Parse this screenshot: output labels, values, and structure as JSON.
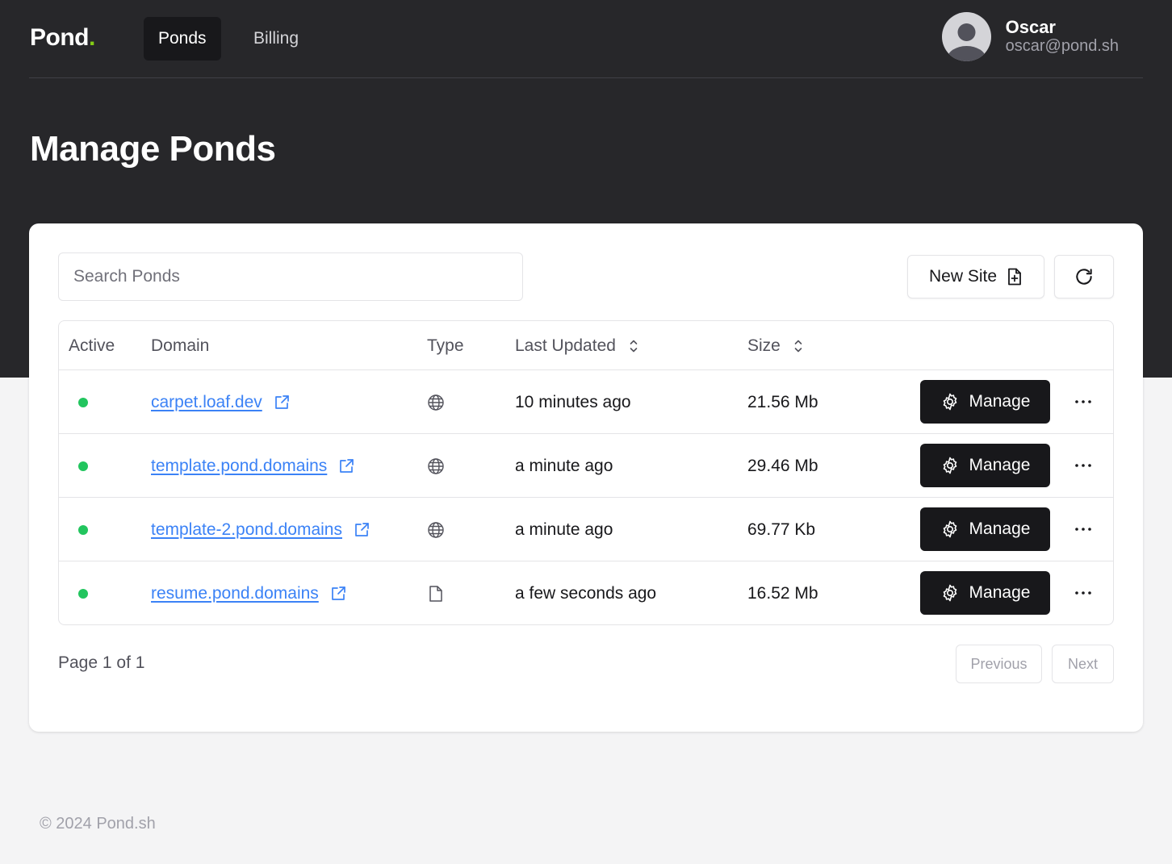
{
  "brand": {
    "name": "Pond",
    "dot": ".",
    "dot_color": "#84cc16"
  },
  "nav": {
    "tabs": [
      {
        "label": "Ponds",
        "active": true
      },
      {
        "label": "Billing",
        "active": false
      }
    ]
  },
  "user": {
    "name": "Oscar",
    "email": "oscar@pond.sh"
  },
  "page": {
    "title": "Manage Ponds"
  },
  "toolbar": {
    "search_placeholder": "Search Ponds",
    "search_value": "",
    "new_site_label": "New Site"
  },
  "table": {
    "headers": {
      "active": "Active",
      "domain": "Domain",
      "type": "Type",
      "last_updated": "Last Updated",
      "size": "Size"
    },
    "rows": [
      {
        "active": true,
        "domain": "carpet.loaf.dev",
        "type_icon": "globe-icon",
        "last_updated": "10 minutes ago",
        "size": "21.56 Mb",
        "action": "Manage"
      },
      {
        "active": true,
        "domain": "template.pond.domains",
        "type_icon": "globe-icon",
        "last_updated": "a minute ago",
        "size": "29.46 Mb",
        "action": "Manage"
      },
      {
        "active": true,
        "domain": "template-2.pond.domains",
        "type_icon": "globe-icon",
        "last_updated": "a minute ago",
        "size": "69.77 Kb",
        "action": "Manage"
      },
      {
        "active": true,
        "domain": "resume.pond.domains",
        "type_icon": "file-icon",
        "last_updated": "a few seconds ago",
        "size": "16.52 Mb",
        "action": "Manage"
      }
    ]
  },
  "pagination": {
    "info": "Page 1 of 1",
    "previous_label": "Previous",
    "next_label": "Next"
  },
  "footer": {
    "copyright": "© 2024 Pond.sh"
  },
  "colors": {
    "active_dot": "#22c55e",
    "link": "#3b82f6",
    "header_bg": "#27272a"
  }
}
